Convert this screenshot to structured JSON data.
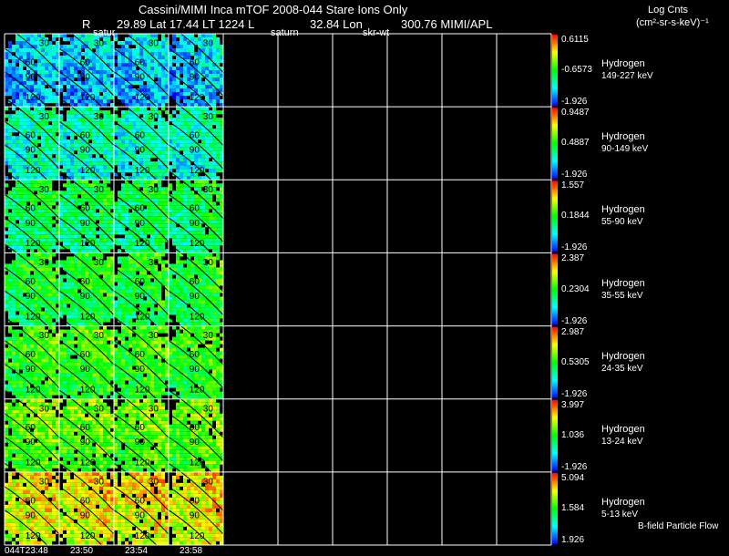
{
  "header": {
    "title_line": "Cassini/MIMI Inca mTOF  2008-044   Stare    Ions Only",
    "info_r": "R",
    "info_main": "29.89 Lat 17.44 LT 1224 L",
    "info_lon": "32.84 Lon",
    "info_right": "300.76  MIMI/APL",
    "overlay_labels": [
      "satur",
      "saturn",
      "skr-wt"
    ],
    "units_line1": "Log Cnts",
    "units_line2": "(cm²-sr-s-keV)⁻¹"
  },
  "footer": {
    "legend_note": "B-field Particle Flow"
  },
  "chart_data": {
    "type": "heatmap",
    "columns": 10,
    "filled_columns": 4,
    "contour_labels": [
      "30",
      "60",
      "90",
      "120"
    ],
    "time_labels": [
      "044T23:48",
      "23:50",
      "23:54",
      "23:58"
    ],
    "colorscale": [
      "#0000ff",
      "#00ffff",
      "#00ff00",
      "#ffff00",
      "#ff0000"
    ],
    "rows": [
      {
        "species": "Hydrogen",
        "energy": "149-227 keV",
        "cmax": "0.6115",
        "cmid": "-0.6573",
        "cmin": "-1.926",
        "level": 0.2
      },
      {
        "species": "Hydrogen",
        "energy": "90-149 keV",
        "cmax": "0.9487",
        "cmid": "0.4887",
        "cmin": "-1.926",
        "level": 0.32
      },
      {
        "species": "Hydrogen",
        "energy": "55-90 keV",
        "cmax": "1.557",
        "cmid": "0.1844",
        "cmin": "-1.926",
        "level": 0.42
      },
      {
        "species": "Hydrogen",
        "energy": "35-55 keV",
        "cmax": "2.387",
        "cmid": "0.2304",
        "cmin": "-1.926",
        "level": 0.47
      },
      {
        "species": "Hydrogen",
        "energy": "24-35 keV",
        "cmax": "2.987",
        "cmid": "0.5305",
        "cmin": "-1.926",
        "level": 0.53
      },
      {
        "species": "Hydrogen",
        "energy": "13-24 keV",
        "cmax": "3.997",
        "cmid": "1.036",
        "cmin": "-1.926",
        "level": 0.58
      },
      {
        "species": "Hydrogen",
        "energy": "5-13 keV",
        "cmax": "5.094",
        "cmid": "1.584",
        "cmin": "1.926",
        "level": 0.74
      }
    ]
  }
}
